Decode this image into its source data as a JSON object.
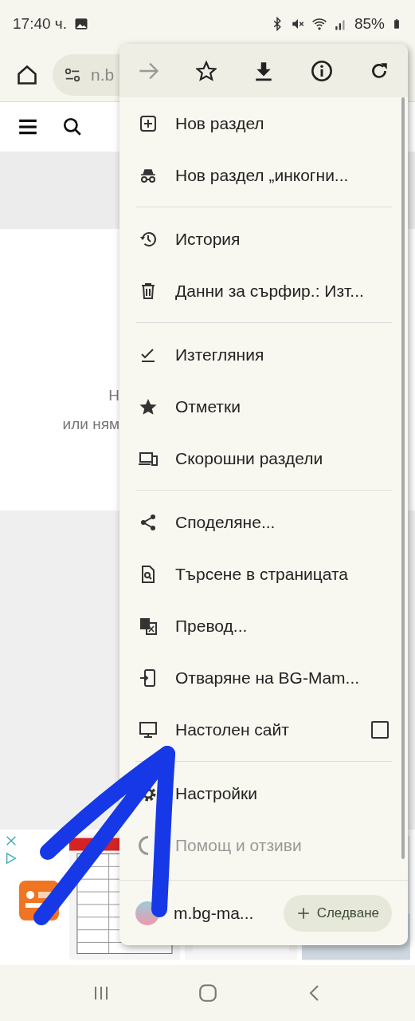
{
  "status_bar": {
    "time": "17:40 ч.",
    "battery": "85%"
  },
  "address_bar": {
    "url": "n.b"
  },
  "page": {
    "lines": [
      "Н",
      "или ням"
    ]
  },
  "menu": {
    "sections": [
      {
        "items": [
          {
            "kind": "item",
            "label": "Нов раздел"
          },
          {
            "kind": "item",
            "label": "Нов раздел „инкогни..."
          }
        ]
      },
      {
        "items": [
          {
            "kind": "item",
            "label": "История"
          },
          {
            "kind": "item",
            "label": "Данни за сърфир.: Изт..."
          }
        ]
      },
      {
        "items": [
          {
            "kind": "item",
            "label": "Изтегляния"
          },
          {
            "kind": "item",
            "label": "Отметки"
          },
          {
            "kind": "item",
            "label": "Скорошни раздели"
          }
        ]
      },
      {
        "items": [
          {
            "kind": "item",
            "label": "Споделяне..."
          },
          {
            "kind": "item",
            "label": "Търсене в страницата"
          },
          {
            "kind": "item",
            "label": "Превод..."
          },
          {
            "kind": "item",
            "label": "Отваряне на BG-Mam..."
          },
          {
            "kind": "checkbox",
            "label": "Настолен сайт",
            "checked": false
          }
        ]
      },
      {
        "items": [
          {
            "kind": "item",
            "label": "Настройки"
          },
          {
            "kind": "item",
            "label": "Помощ и отзиви"
          }
        ]
      }
    ],
    "footer": {
      "site": "m.bg-ma...",
      "follow_button": "Следване"
    }
  }
}
